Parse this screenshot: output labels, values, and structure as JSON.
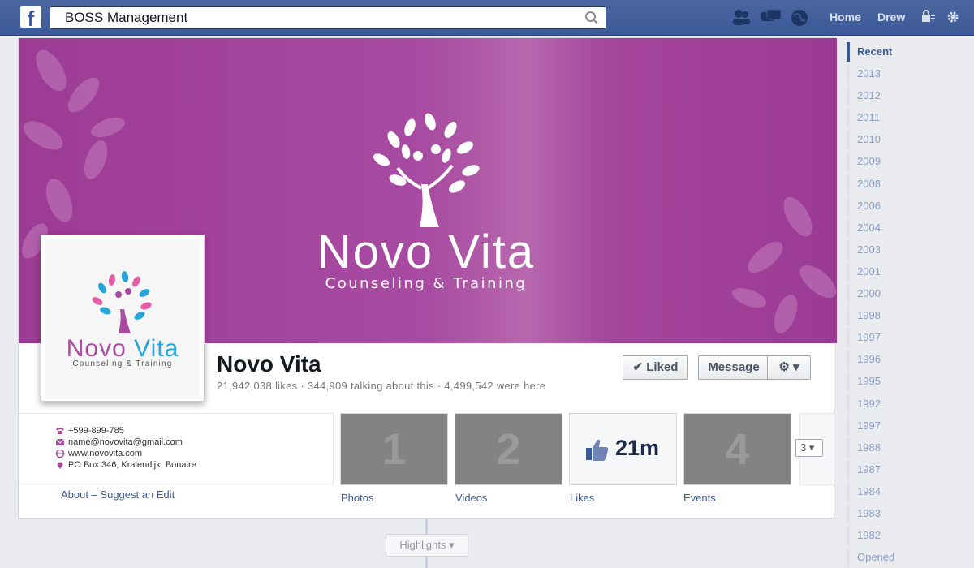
{
  "topbar": {
    "logo": "f",
    "search_value": "BOSS Management",
    "home_label": "Home",
    "user_label": "Drew"
  },
  "cover": {
    "title": "Novo Vita",
    "subtitle": "Counseling & Training"
  },
  "profile": {
    "logo_title_part1": "Novo",
    "logo_title_part2": "Vita",
    "logo_subtitle": "Counseling & Training"
  },
  "page": {
    "name": "Novo Vita",
    "stats": "21,942,038 likes · 344,909 talking about this · 4,499,542 were here",
    "liked_label": "✔ Liked",
    "message_label": "Message",
    "gear_label": "⚙ ▾"
  },
  "about": {
    "phone": "+599-899-785",
    "email": "name@novovita@gmail.com",
    "website": "www.novovita.com",
    "address": "PO Box 346, Kralendijk, Bonaire",
    "link": "About – Suggest an Edit"
  },
  "apps": [
    {
      "thumb": "1",
      "label": "Photos"
    },
    {
      "thumb": "2",
      "label": "Videos"
    },
    {
      "thumb": "21m",
      "label": "Likes"
    },
    {
      "thumb": "4",
      "label": "Events"
    }
  ],
  "more_label": "3 ▾",
  "highlights_label": "Highlights ▾",
  "years": [
    "Recent",
    "2013",
    "2012",
    "2011",
    "2010",
    "2009",
    "2008",
    "2006",
    "2004",
    "2003",
    "2001",
    "2000",
    "1998",
    "1997",
    "1996",
    "1995",
    "1992",
    "1997",
    "1988",
    "1987",
    "1984",
    "1983",
    "1982",
    "Opened"
  ],
  "colors": {
    "facebook_blue": "#3b5998",
    "cover_purple": "#a84ba2",
    "logo_cyan": "#27a4d8"
  }
}
